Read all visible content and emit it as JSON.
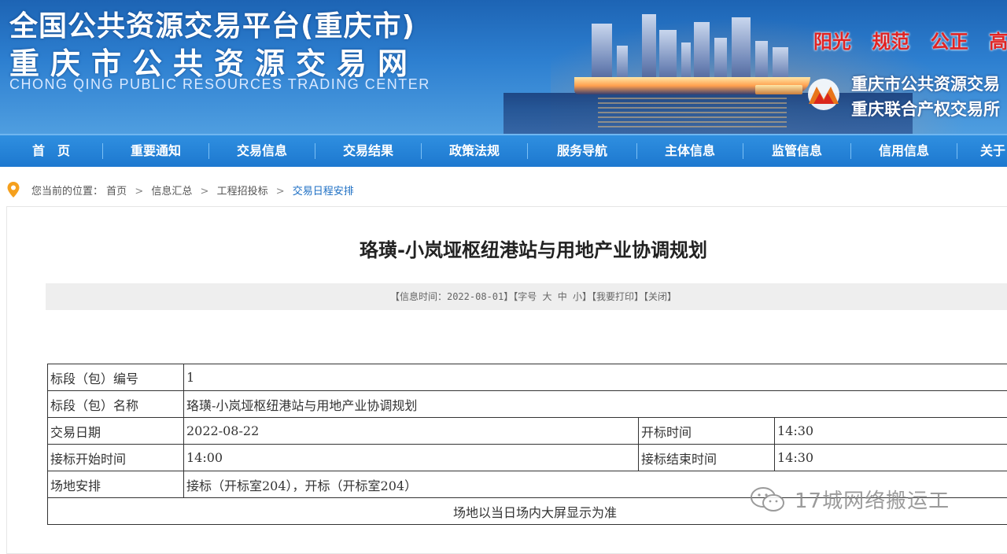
{
  "header": {
    "title_line1": "全国公共资源交易平台(重庆市)",
    "title_line2": "重庆市公共资源交易网",
    "title_en": "CHONG QING PUBLIC RESOURCES TRADING CENTER",
    "slogan": [
      "阳光",
      "规范",
      "公正",
      "高效"
    ],
    "org_line1": "重庆市公共资源交易",
    "org_line2": "重庆联合产权交易所",
    "logo_icon": "org-logo-icon",
    "accent_color": "#e02323"
  },
  "nav": {
    "items": [
      "首　页",
      "重要通知",
      "交易信息",
      "交易结果",
      "政策法规",
      "服务导航",
      "主体信息",
      "监管信息",
      "信用信息",
      "关于"
    ]
  },
  "breadcrumb": {
    "prefix": "您当前的位置：",
    "items": [
      "首页",
      "信息汇总",
      "工程招投标",
      "交易日程安排"
    ],
    "separator": ">",
    "icon": "location-pin-icon"
  },
  "article": {
    "title": "珞璜-小岚垭枢纽港站与用地产业协调规划",
    "info_time": "【信息时间：2022-08-01】",
    "font_size_label": "【字号",
    "font_large": "大",
    "font_medium": "中",
    "font_small": "小】",
    "print": "【我要打印】",
    "close": "【关闭】"
  },
  "table": {
    "rows": [
      {
        "label": "标段（包）编号",
        "value": "1"
      },
      {
        "label": "标段（包）名称",
        "value": "珞璜-小岚垭枢纽港站与用地产业协调规划"
      },
      {
        "label": "交易日期",
        "value": "2022-08-22",
        "label2": "开标时间",
        "value2": "14:30"
      },
      {
        "label": "接标开始时间",
        "value": "14:00",
        "label2": "接标结束时间",
        "value2": "14:30"
      },
      {
        "label": "场地安排",
        "value": "接标（开标室204），开标（开标室204）"
      }
    ],
    "note": "场地以当日场内大屏显示为准"
  },
  "watermark": {
    "text": "17城网络搬运工",
    "icon": "wechat-icon"
  }
}
